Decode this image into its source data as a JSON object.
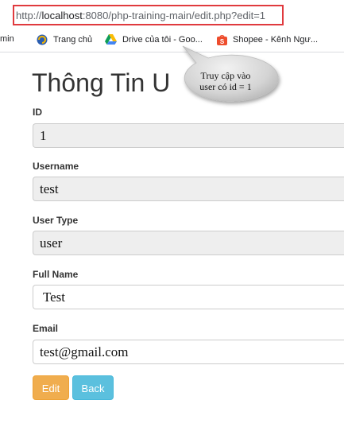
{
  "browser": {
    "url_prefix": "http://",
    "url_host": "localhost",
    "url_rest": ":8080/php-training-main/edit.php?edit=1"
  },
  "bookmarks": [
    {
      "label": "min",
      "icon": "bookmark-icon"
    },
    {
      "label": "Trang chủ",
      "icon": "home-shortcut-icon"
    },
    {
      "label": "Drive của tôi - Goo...",
      "icon": "google-drive-icon"
    },
    {
      "label": "Shopee - Kênh Ngư...",
      "icon": "shopee-icon"
    }
  ],
  "annotation": {
    "line1": "Truy cập vào",
    "line2": "user có id = 1"
  },
  "form": {
    "title": "Thông Tin U",
    "fields": [
      {
        "label": "ID",
        "value": "1"
      },
      {
        "label": "Username",
        "value": "test"
      },
      {
        "label": "User Type",
        "value": "user"
      },
      {
        "label": "Full Name",
        "value": " Test"
      },
      {
        "label": "Email",
        "value": "test@gmail.com"
      }
    ],
    "edit_label": "Edit",
    "back_label": "Back"
  },
  "colors": {
    "url_highlight": "#e03a3e",
    "edit_button": "#f0ad4e",
    "back_button": "#5bc0de",
    "readonly_field": "#eeeeee"
  }
}
